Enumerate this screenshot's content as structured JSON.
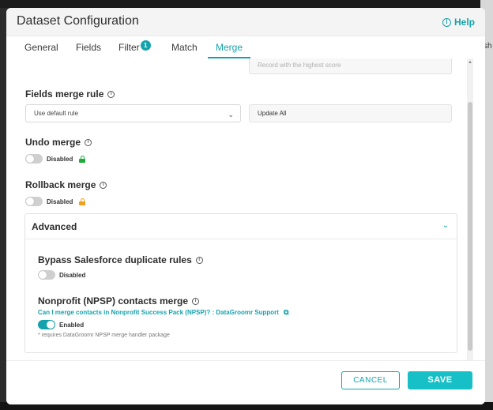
{
  "window": {
    "title": "Dataset Configuration",
    "help_label": "Help",
    "background_peek": "sh"
  },
  "tabs": [
    {
      "label": "General",
      "active": false
    },
    {
      "label": "Fields",
      "active": false
    },
    {
      "label": "Filter",
      "active": false,
      "badge": "1"
    },
    {
      "label": "Match",
      "active": false
    },
    {
      "label": "Merge",
      "active": true
    }
  ],
  "merge": {
    "top_field_value": "Record with the highest score",
    "fields_merge_rule": {
      "label": "Fields merge rule",
      "select_value": "Use default rule",
      "value": "Update All"
    },
    "undo_merge": {
      "label": "Undo merge",
      "toggle_label": "Disabled",
      "enabled": false,
      "lock_color": "#1faa3c"
    },
    "rollback_merge": {
      "label": "Rollback merge",
      "toggle_label": "Disabled",
      "enabled": false,
      "lock_color": "#f0a11f"
    },
    "advanced": {
      "title": "Advanced",
      "bypass": {
        "label": "Bypass Salesforce duplicate rules",
        "toggle_label": "Disabled",
        "enabled": false
      },
      "npsp": {
        "label": "Nonprofit (NPSP) contacts merge",
        "link_text": "Can I merge contacts in Nonprofit Success Pack (NPSP)? : DataGroomr Support",
        "toggle_label": "Enabled",
        "enabled": true,
        "note": "* requires DataGroomr NPSP merge handler package"
      }
    }
  },
  "footer": {
    "cancel_label": "CANCEL",
    "save_label": "SAVE"
  },
  "colors": {
    "accent": "#14a3ad",
    "save_button": "#17bfc6"
  }
}
